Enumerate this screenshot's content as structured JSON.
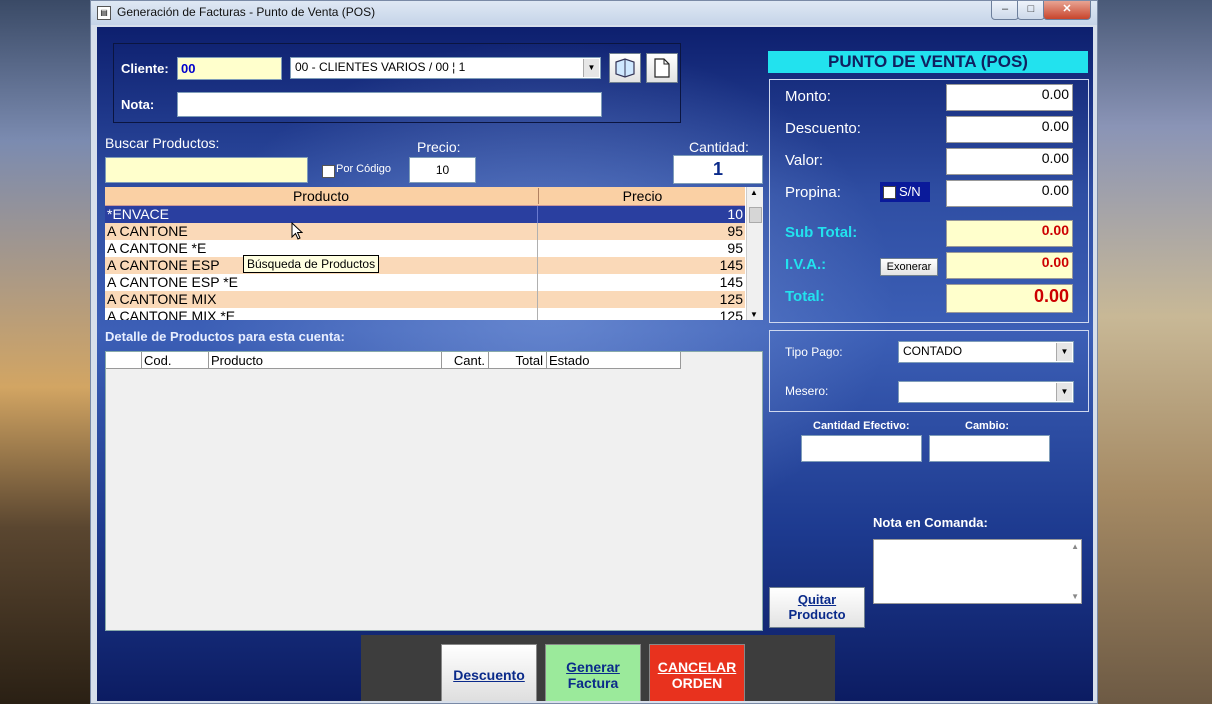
{
  "window": {
    "title": "Generación de Facturas - Punto de Venta (POS)"
  },
  "cliente": {
    "label": "Cliente:",
    "code": "00",
    "selected": "00 - CLIENTES VARIOS / 00 ¦ 1"
  },
  "nota": {
    "label": "Nota:",
    "value": ""
  },
  "search": {
    "label": "Buscar Productos:",
    "value": "",
    "por_codigo": "Por Código"
  },
  "precio": {
    "label": "Precio:",
    "value": "10"
  },
  "cantidad": {
    "label": "Cantidad:",
    "value": "1"
  },
  "products": {
    "headers": [
      "Producto",
      "Precio"
    ],
    "rows": [
      {
        "name": "*ENVACE",
        "price": "10"
      },
      {
        "name": "A CANTONE",
        "price": "95"
      },
      {
        "name": "A CANTONE *E",
        "price": "95"
      },
      {
        "name": "A CANTONE ESP",
        "price": "145"
      },
      {
        "name": "A CANTONE ESP *E",
        "price": "145"
      },
      {
        "name": "A CANTONE MIX",
        "price": "125"
      },
      {
        "name": "A CANTONE MIX *E",
        "price": "125"
      }
    ],
    "tooltip": "Búsqueda de Productos"
  },
  "detail": {
    "title": "Detalle de Productos para esta cuenta:",
    "headers": [
      "",
      "Cod.",
      "Producto",
      "Cant.",
      "Total",
      "Estado"
    ]
  },
  "pos": {
    "title": "PUNTO DE VENTA (POS)",
    "monto": {
      "label": "Monto:",
      "value": "0.00"
    },
    "descuento": {
      "label": "Descuento:",
      "value": "0.00"
    },
    "valor": {
      "label": "Valor:",
      "value": "0.00"
    },
    "propina": {
      "label": "Propina:",
      "value": "0.00",
      "sn": "S/N"
    },
    "subtotal": {
      "label": "Sub Total:",
      "value": "0.00"
    },
    "iva": {
      "label": "I.V.A.:",
      "value": "0.00",
      "exonerar": "Exonerar"
    },
    "total": {
      "label": "Total:",
      "value": "0.00"
    }
  },
  "payment": {
    "tipo_label": "Tipo Pago:",
    "tipo_value": "CONTADO",
    "mesero_label": "Mesero:",
    "mesero_value": ""
  },
  "efectivo": {
    "label": "Cantidad Efectivo:",
    "value": "",
    "cambio_label": "Cambio:",
    "cambio_value": ""
  },
  "comanda": {
    "label": "Nota en Comanda:",
    "value": ""
  },
  "buttons": {
    "quitar": [
      "Quitar",
      "Producto"
    ],
    "descuento": "Descuento",
    "generar": [
      "Generar",
      "Factura"
    ],
    "cancelar": [
      "CANCELAR",
      "ORDEN"
    ]
  },
  "colors": {
    "pos_title_bg": "#22e2ee",
    "total_red": "#cc0000",
    "yellow_field": "#ffffcc",
    "generar_green": "#9bea9b",
    "cancelar_red": "#e8321e"
  }
}
